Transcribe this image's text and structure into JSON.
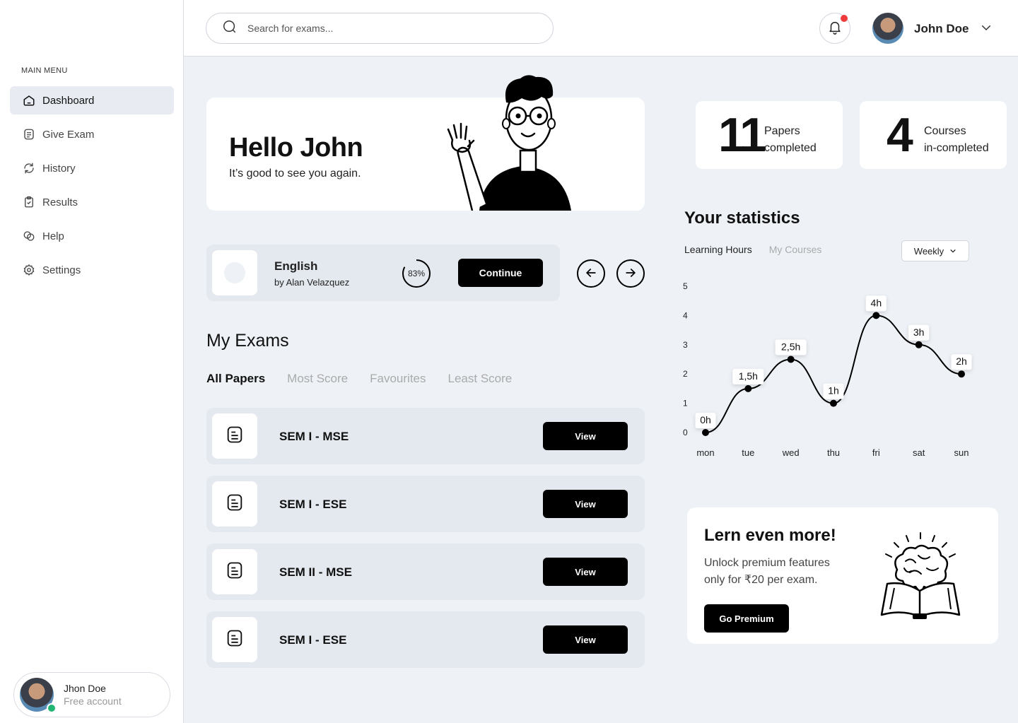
{
  "sidebar": {
    "menu_title": "MAIN MENU",
    "items": [
      {
        "label": "Dashboard",
        "icon": "home-icon",
        "active": true
      },
      {
        "label": "Give Exam",
        "icon": "document-icon"
      },
      {
        "label": "History",
        "icon": "refresh-icon"
      },
      {
        "label": "Results",
        "icon": "clipboard-check-icon"
      },
      {
        "label": "Help",
        "icon": "help-icon"
      },
      {
        "label": "Settings",
        "icon": "gear-icon"
      }
    ],
    "user": {
      "name": "Jhon Doe",
      "plan": "Free account"
    }
  },
  "header": {
    "search_placeholder": "Search for exams...",
    "user_name": "John Doe"
  },
  "hello": {
    "title": "Hello John",
    "subtitle": "It’s good to see you again."
  },
  "course": {
    "title": "English",
    "author": "by Alan Velazquez",
    "progress": 83,
    "progress_label": "83%",
    "continue_label": "Continue"
  },
  "exams": {
    "title": "My Exams",
    "tabs": [
      "All Papers",
      "Most Score",
      "Favourites",
      "Least Score"
    ],
    "active_tab": 0,
    "view_label": "View",
    "rows": [
      {
        "name": "SEM I - MSE"
      },
      {
        "name": "SEM I - ESE"
      },
      {
        "name": "SEM II - MSE"
      },
      {
        "name": "SEM I - ESE"
      }
    ]
  },
  "summary": {
    "papers": {
      "value": "11",
      "label_line1": "Papers",
      "label_line2": "completed"
    },
    "courses": {
      "value": "4",
      "label_line1": "Courses",
      "label_line2": "in-completed"
    }
  },
  "statistics": {
    "title": "Your statistics",
    "tabs": [
      "Learning Hours",
      "My Courses"
    ],
    "active_tab": 0,
    "period": "Weekly"
  },
  "chart_data": {
    "type": "line",
    "categories": [
      "mon",
      "tue",
      "wed",
      "thu",
      "fri",
      "sat",
      "sun"
    ],
    "values": [
      0,
      1.5,
      2.5,
      1,
      4,
      3,
      2
    ],
    "point_labels": [
      "0h",
      "1,5h",
      "2,5h",
      "1h",
      "4h",
      "3h",
      "2h"
    ],
    "yticks": [
      "0",
      "1",
      "2",
      "3",
      "4",
      "5"
    ],
    "ylim": [
      0,
      5
    ],
    "grid": false,
    "color": "#000000"
  },
  "premium": {
    "title": "Lern even more!",
    "text": "Unlock premium features only for ₹20 per exam.",
    "button": "Go Premium"
  },
  "colors": {
    "accent": "#000000",
    "background": "#eef2f7",
    "notification": "#ee3b3b",
    "online": "#22b573"
  }
}
